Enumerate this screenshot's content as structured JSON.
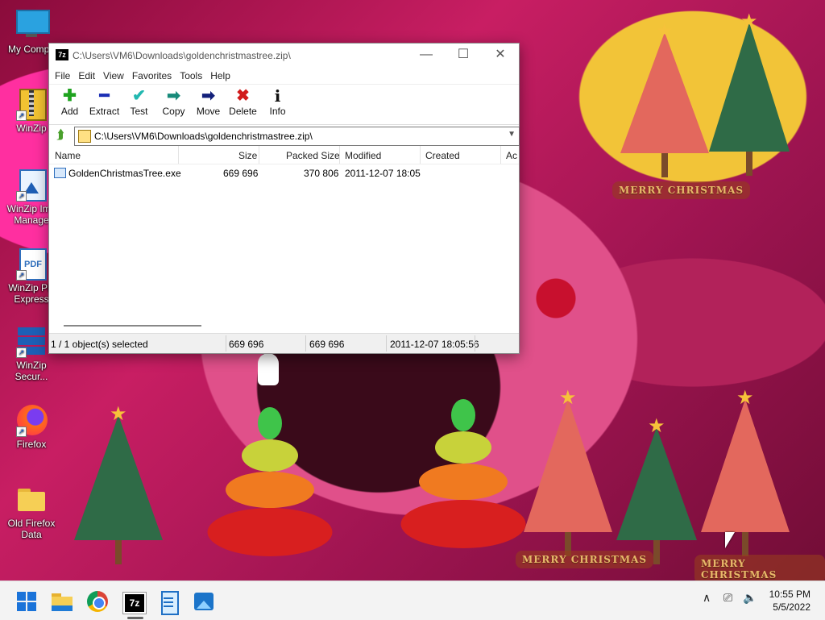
{
  "desktop": {
    "icons": [
      {
        "label": "My Compu",
        "icon": "monitor-icon"
      },
      {
        "label": "WinZip",
        "icon": "winzip-icon"
      },
      {
        "label": "WinZip Ima Manage",
        "icon": "image-manager-icon"
      },
      {
        "label": "WinZip PD Express",
        "icon": "pdf-icon"
      },
      {
        "label": "WinZip Secur...",
        "icon": "secure-icon"
      },
      {
        "label": "Firefox",
        "icon": "firefox-icon"
      },
      {
        "label": "Old Firefox Data",
        "icon": "folder-icon"
      }
    ],
    "decoration_text": [
      "MERRY CHRISTMAS",
      "MERRY CHRISTMAS",
      "MERRY CHRISTMAS"
    ]
  },
  "window": {
    "app_icon_text": "7z",
    "title": "C:\\Users\\VM6\\Downloads\\goldenchristmastree.zip\\",
    "controls": {
      "minimize": "—",
      "maximize": "☐",
      "close": "✕"
    },
    "menu": [
      "File",
      "Edit",
      "View",
      "Favorites",
      "Tools",
      "Help"
    ],
    "toolbar": [
      {
        "label": "Add",
        "icon": "plus-icon",
        "glyph": "✚",
        "color": "#1fa31f"
      },
      {
        "label": "Extract",
        "icon": "minus-icon",
        "glyph": "━",
        "color": "#1b2fb5"
      },
      {
        "label": "Test",
        "icon": "check-icon",
        "glyph": "✔",
        "color": "#22b8b0"
      },
      {
        "label": "Copy",
        "icon": "copy-arrow-icon",
        "glyph": "➡",
        "color": "#178a7a"
      },
      {
        "label": "Move",
        "icon": "move-arrow-icon",
        "glyph": "➡",
        "color": "#13207a"
      },
      {
        "label": "Delete",
        "icon": "delete-icon",
        "glyph": "✖",
        "color": "#d11a1a"
      },
      {
        "label": "Info",
        "icon": "info-icon",
        "glyph": "i",
        "color": "#111"
      }
    ],
    "address": "C:\\Users\\VM6\\Downloads\\goldenchristmastree.zip\\",
    "columns": [
      "Name",
      "Size",
      "Packed Size",
      "Modified",
      "Created",
      "Ac"
    ],
    "files": [
      {
        "name": "GoldenChristmasTree.exe",
        "size": "669 696",
        "packed": "370 806",
        "modified": "2011-12-07 18:05",
        "created": ""
      }
    ],
    "status": {
      "selection": "1 / 1 object(s) selected",
      "size": "669 696",
      "packed": "669 696",
      "modified": "2011-12-07 18:05:56"
    }
  },
  "taskbar": {
    "apps": [
      "start-icon",
      "file-explorer-icon",
      "chrome-icon",
      "7zip-icon",
      "notepad-icon",
      "photos-icon"
    ],
    "active_app_label": "7z",
    "tray": {
      "chevron": "∧",
      "network": "⎚",
      "volume": "🔈"
    },
    "clock": {
      "time": "10:55 PM",
      "date": "5/5/2022"
    }
  }
}
